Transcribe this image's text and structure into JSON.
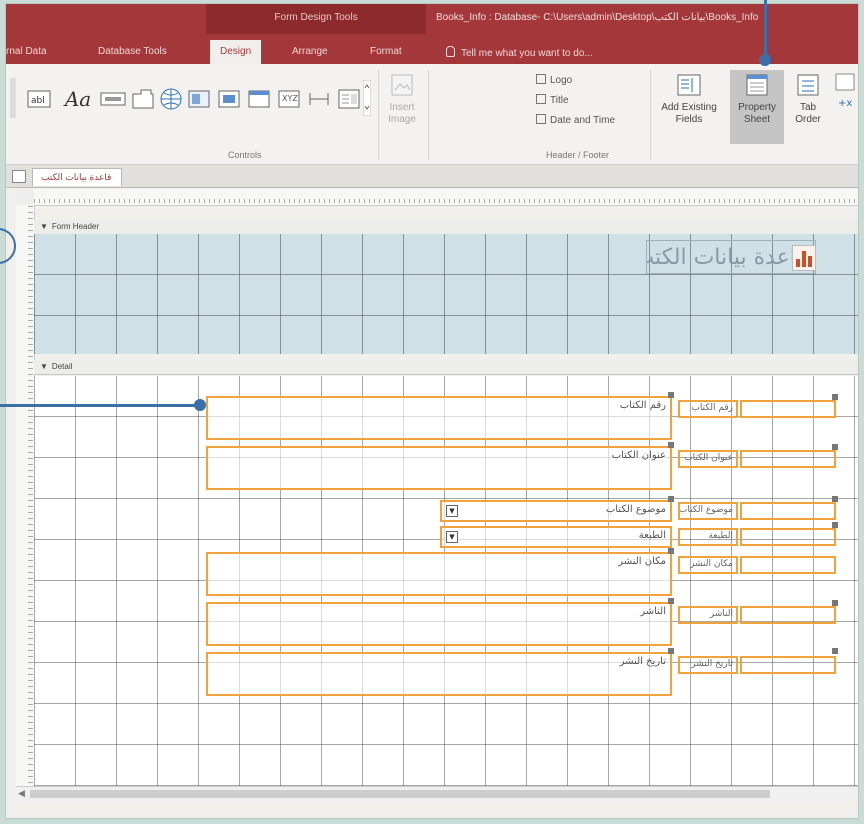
{
  "titlebar": {
    "context_title": "Form Design Tools",
    "doc_title": "Books_Info : Database- C:\\Users\\admin\\Desktop\\بيانات الكتب\\Books_Info"
  },
  "tabs": [
    {
      "label": "rnal Data"
    },
    {
      "label": "Database Tools"
    },
    {
      "label": "Design",
      "active": true
    },
    {
      "label": "Arrange"
    },
    {
      "label": "Format"
    }
  ],
  "tell_me": "Tell me what you want to do...",
  "ribbon": {
    "controls_group_label": "Controls",
    "insert_image_label": "Insert Image",
    "header_footer": {
      "label": "Header / Footer",
      "logo": "Logo",
      "title": "Title",
      "date_time": "Date and Time"
    },
    "add_existing_fields": "Add Existing Fields",
    "property_sheet": "Property Sheet",
    "tab_order": "Tab Order"
  },
  "doc_tab": "قاعدة بيانات الكتب",
  "sections": {
    "form_header": "Form Header",
    "detail": "Detail"
  },
  "form_title": "قاعدة بيانات الكتب",
  "detail_controls": [
    {
      "text": "رقم الكتاب",
      "label": "رقم الكتاب"
    },
    {
      "text": "عنوان الكتاب",
      "label": "عنوان الكتاب"
    },
    {
      "text": "موضوع الكتاب",
      "label": "موضوع الكتاب"
    },
    {
      "text": "الطبعة",
      "label": "الطبعة"
    },
    {
      "text": "مكان النشر",
      "label": "مكان النشر"
    },
    {
      "text": "الناشر",
      "label": "الناشر"
    },
    {
      "text": "تاريخ النشر",
      "label": "تاريخ النشر"
    }
  ],
  "colors": {
    "accent": "#a4373a",
    "selection": "#f0a33a",
    "callout": "#3b6fa8"
  }
}
